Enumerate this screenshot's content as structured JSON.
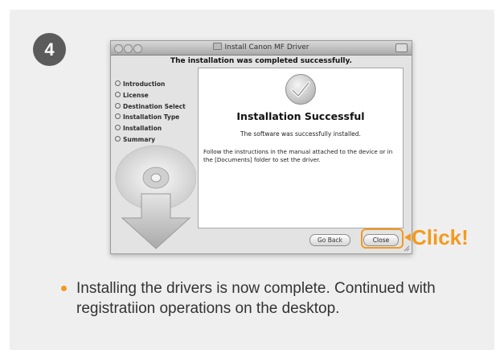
{
  "step_number": "4",
  "window": {
    "title": "Install Canon MF Driver",
    "heading": "The installation was completed successfully."
  },
  "sidebar": {
    "steps": [
      {
        "label": "Introduction"
      },
      {
        "label": "License"
      },
      {
        "label": "Destination Select"
      },
      {
        "label": "Installation Type"
      },
      {
        "label": "Installation"
      },
      {
        "label": "Summary"
      }
    ]
  },
  "content": {
    "title": "Installation Successful",
    "message": "The software was successfully installed.",
    "instructions": "Follow the instructions in the manual attached to the device or in the [Documents] folder to set the driver."
  },
  "buttons": {
    "go_back": "Go Back",
    "close": "Close"
  },
  "callout": {
    "label": "Click!",
    "color": "#f39a1e"
  },
  "note": {
    "text": "Installing the drivers is now complete. Continued with registratiion operations on the desktop."
  }
}
